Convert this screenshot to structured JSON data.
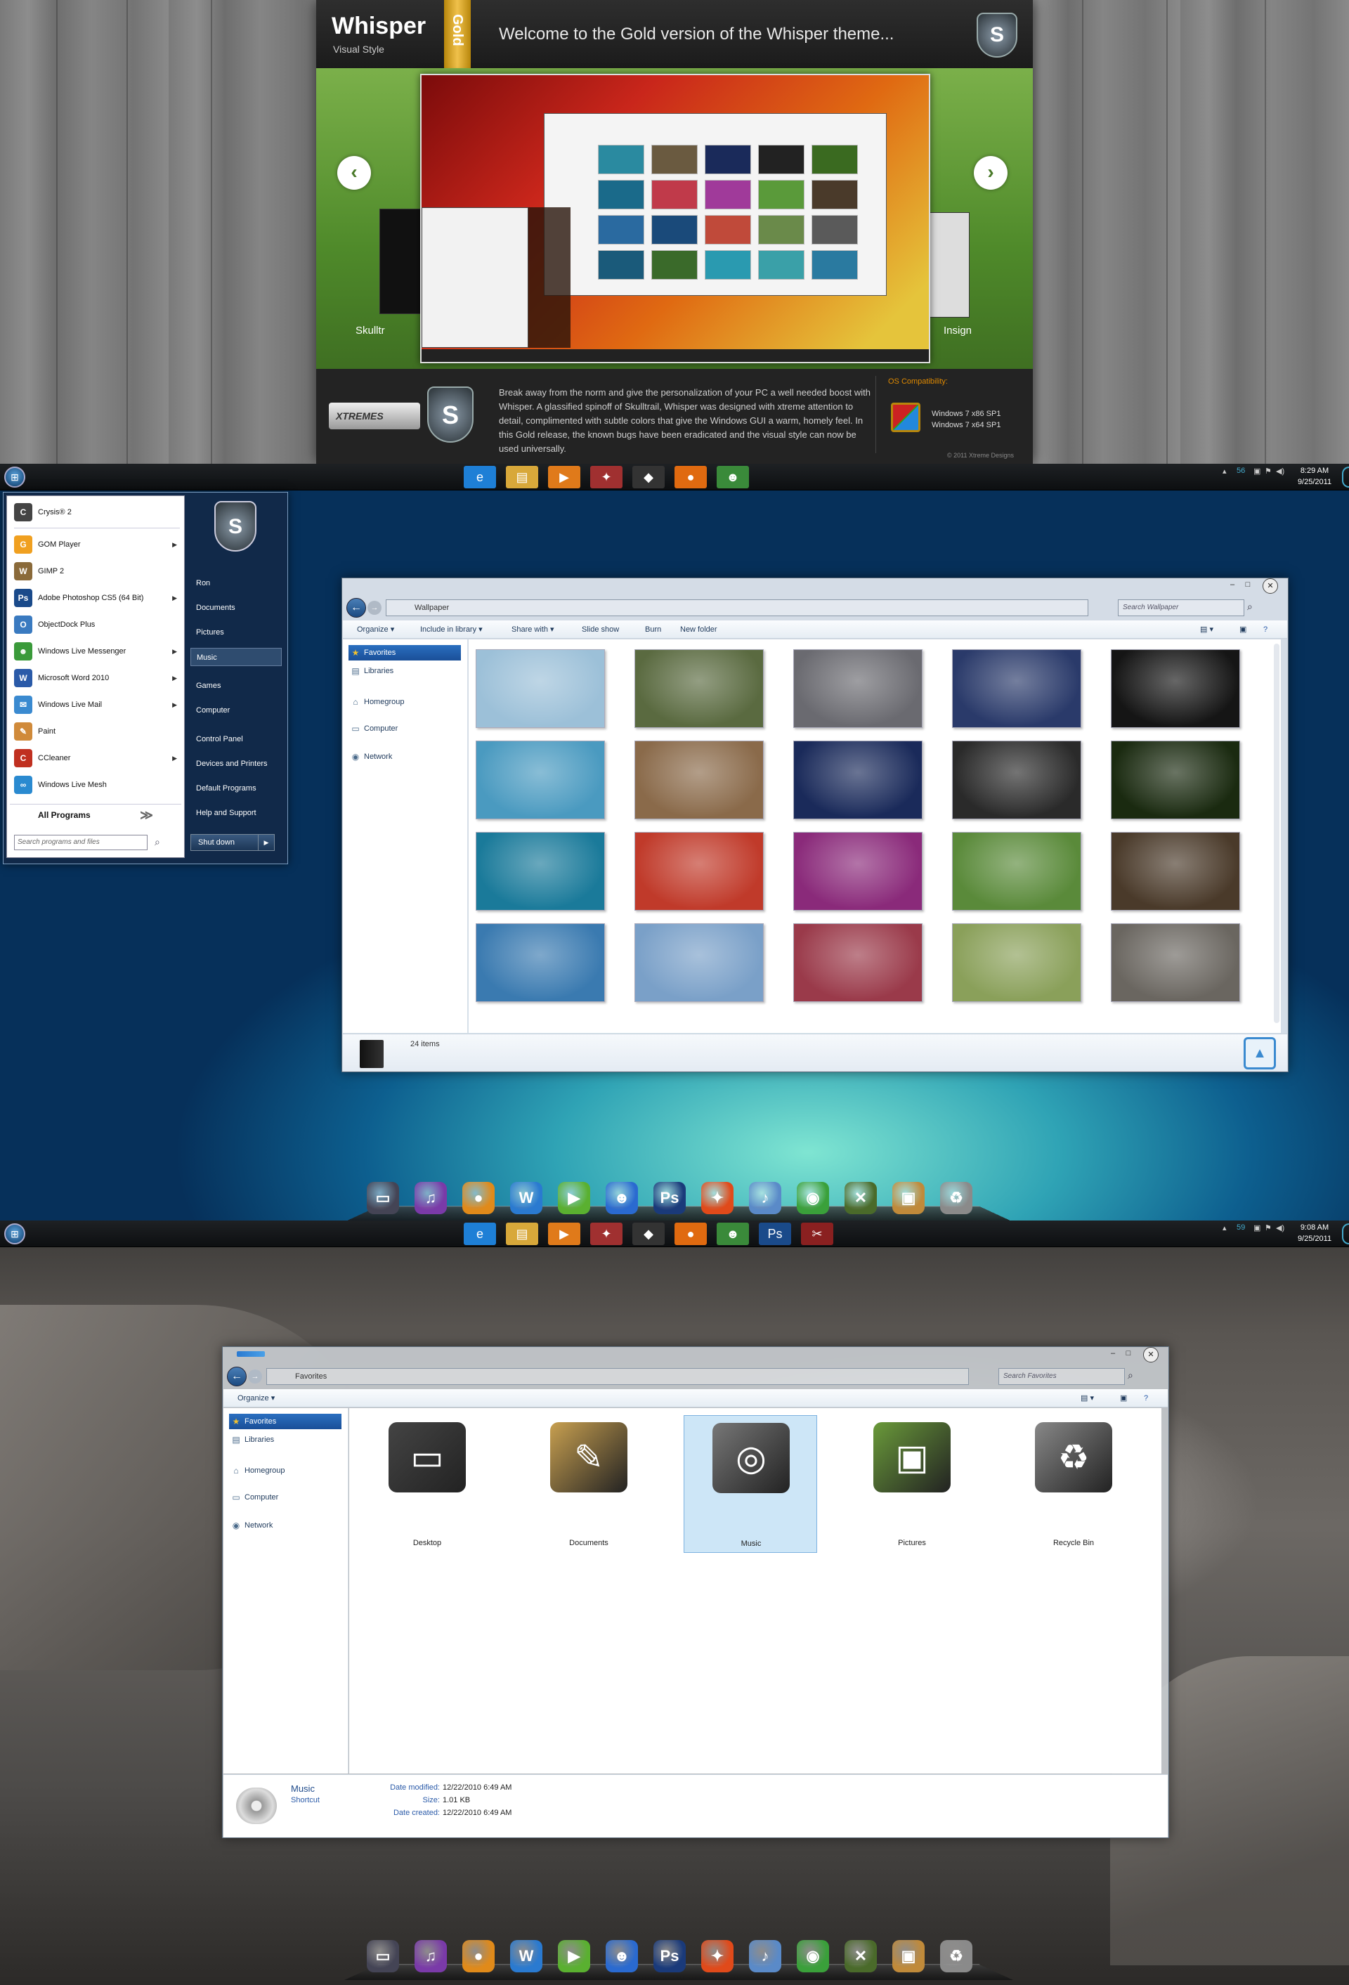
{
  "banner": {
    "logo_title": "Whisper",
    "logo_subtitle": "Visual Style",
    "ribbon_label": "Gold",
    "welcome": "Welcome to the Gold version of the Whisper theme...",
    "badge_letter": "S",
    "prev_arrow": "‹",
    "next_arrow": "›",
    "left_slide_label": "Skulltr",
    "right_slide_label": "Insign",
    "xtreme_logo": "XTREMES",
    "description": "Break away from the norm and give the personalization of your PC a well needed boost with Whisper. A glassified spinoff of Skulltrail, Whisper was designed with xtreme attention to detail, complimented with subtle colors that give the Windows GUI a warm, homely feel. In this Gold release, the known bugs have been eradicated and the visual style can now be used universally.",
    "compat_title": "OS Compatibility:",
    "compat_items": [
      "Windows 7 x86 SP1",
      "Windows 7 x64 SP1"
    ],
    "copyright": "© 2011 Xtreme Designs"
  },
  "taskbar1": {
    "orb": "⊞",
    "icons": [
      {
        "name": "internet-explorer-icon",
        "glyph": "e",
        "color": "#1e7fd6"
      },
      {
        "name": "explorer-icon",
        "glyph": "▤",
        "color": "#d8a83a"
      },
      {
        "name": "media-player-icon",
        "glyph": "▶",
        "color": "#e07a1a"
      },
      {
        "name": "app-icon",
        "glyph": "✦",
        "color": "#a03030"
      },
      {
        "name": "game-icon",
        "glyph": "◆",
        "color": "#333"
      },
      {
        "name": "firefox-icon",
        "glyph": "●",
        "color": "#e06a10"
      },
      {
        "name": "messenger-icon",
        "glyph": "☻",
        "color": "#3a8a3a"
      }
    ],
    "tray_network": "56",
    "clock_time": "8:29 AM",
    "clock_date": "9/25/2011"
  },
  "startmenu": {
    "pinned": {
      "label": "Crysis® 2",
      "icon": "C",
      "color": "#444"
    },
    "items": [
      {
        "label": "GOM Player",
        "icon": "G",
        "color": "#f0a020",
        "arrow": true
      },
      {
        "label": "GIMP 2",
        "icon": "W",
        "color": "#8a6a3a",
        "arrow": false
      },
      {
        "label": "Adobe Photoshop CS5 (64 Bit)",
        "icon": "Ps",
        "color": "#1a4a8a",
        "arrow": true
      },
      {
        "label": "ObjectDock Plus",
        "icon": "O",
        "color": "#3a7ac0",
        "arrow": false
      },
      {
        "label": "Windows Live Messenger",
        "icon": "☻",
        "color": "#3a9a3a",
        "arrow": true
      },
      {
        "label": "Microsoft Word 2010",
        "icon": "W",
        "color": "#2a5aa8",
        "arrow": true
      },
      {
        "label": "Windows Live Mail",
        "icon": "✉",
        "color": "#3a8ad0",
        "arrow": true
      },
      {
        "label": "Paint",
        "icon": "✎",
        "color": "#d08a3a",
        "arrow": false
      },
      {
        "label": "CCleaner",
        "icon": "C",
        "color": "#c03020",
        "arrow": true
      },
      {
        "label": "Windows Live Mesh",
        "icon": "∞",
        "color": "#2a8ad0",
        "arrow": false
      }
    ],
    "all_programs": "All Programs",
    "search_placeholder": "Search programs and files",
    "right_items": [
      "Ron",
      "Documents",
      "Pictures",
      "Music",
      "Games",
      "Computer",
      "Control Panel",
      "Devices and Printers",
      "Default Programs",
      "Help and Support"
    ],
    "shutdown": "Shut down"
  },
  "wallpaper_window": {
    "address": "Wallpaper",
    "search_placeholder": "Search Wallpaper",
    "toolbar": [
      "Organize ▾",
      "Include in library ▾",
      "Share with ▾",
      "Slide show",
      "Burn",
      "New folder"
    ],
    "nav": [
      "Favorites",
      "Libraries",
      "Homegroup",
      "Computer",
      "Network"
    ],
    "status": "24 items",
    "thumbs": [
      "#9cc0d8",
      "#5a6a40",
      "#6a6a70",
      "#2a3a6a",
      "#151515",
      "#4a9ac0",
      "#8a6a4a",
      "#1a2a5a",
      "#2a2a2a",
      "#1a2a10",
      "#1a7a9a",
      "#c03a2a",
      "#8a2a7a",
      "#5a8a3a",
      "#4a3a2a",
      "#3a7ab0",
      "#7aa0c8",
      "#9a3a4a",
      "#8aa05a",
      "#6a6660"
    ]
  },
  "dock1": {
    "icons": [
      {
        "name": "monitor-icon",
        "glyph": "▭",
        "color": "#445"
      },
      {
        "name": "music-icon",
        "glyph": "♫",
        "color": "#7a3aa8"
      },
      {
        "name": "gom-icon",
        "glyph": "●",
        "color": "#e08a1a"
      },
      {
        "name": "live-icon",
        "glyph": "W",
        "color": "#2a7ad0"
      },
      {
        "name": "play-icon",
        "glyph": "▶",
        "color": "#5ab030"
      },
      {
        "name": "messenger-icon",
        "glyph": "☻",
        "color": "#2a6ad0"
      },
      {
        "name": "photoshop-icon",
        "glyph": "Ps",
        "color": "#1a3a7a"
      },
      {
        "name": "fire-icon",
        "glyph": "✦",
        "color": "#e04a1a"
      },
      {
        "name": "itunes-icon",
        "glyph": "♪",
        "color": "#5a8ac8"
      },
      {
        "name": "chrome-icon",
        "glyph": "◉",
        "color": "#3aa03a"
      },
      {
        "name": "xbox-icon",
        "glyph": "✕",
        "color": "#4a6a2a"
      },
      {
        "name": "box-icon",
        "glyph": "▣",
        "color": "#c08a3a"
      },
      {
        "name": "recycle-bin-icon",
        "glyph": "♻",
        "color": "#8a8a8a"
      }
    ]
  },
  "taskbar2": {
    "orb": "⊞",
    "icons": [
      {
        "name": "internet-explorer-icon",
        "glyph": "e",
        "color": "#1e7fd6"
      },
      {
        "name": "explorer-icon",
        "glyph": "▤",
        "color": "#d8a83a"
      },
      {
        "name": "media-player-icon",
        "glyph": "▶",
        "color": "#e07a1a"
      },
      {
        "name": "app-icon",
        "glyph": "✦",
        "color": "#a03030"
      },
      {
        "name": "game-icon",
        "glyph": "◆",
        "color": "#333"
      },
      {
        "name": "firefox-icon",
        "glyph": "●",
        "color": "#e06a10"
      },
      {
        "name": "messenger-icon",
        "glyph": "☻",
        "color": "#3a8a3a"
      },
      {
        "name": "photoshop-icon",
        "glyph": "Ps",
        "color": "#1a4a8a"
      },
      {
        "name": "tools-icon",
        "glyph": "✂",
        "color": "#8a2020"
      }
    ],
    "tray_network": "59",
    "clock_time": "9:08 AM",
    "clock_date": "9/25/2011"
  },
  "favorites_window": {
    "address": "Favorites",
    "search_placeholder": "Search Favorites",
    "toolbar": [
      "Organize ▾"
    ],
    "nav": [
      "Favorites",
      "Libraries",
      "Homegroup",
      "Computer",
      "Network"
    ],
    "items": [
      {
        "label": "Desktop",
        "glyph": "▭",
        "color": "#444"
      },
      {
        "label": "Documents",
        "glyph": "✎",
        "color": "#c8a050"
      },
      {
        "label": "Music",
        "glyph": "◎",
        "color": "#777"
      },
      {
        "label": "Pictures",
        "glyph": "▣",
        "color": "#6a9a3a"
      },
      {
        "label": "Recycle Bin",
        "glyph": "♻",
        "color": "#888"
      }
    ],
    "details": {
      "name": "Music",
      "type": "Shortcut",
      "modified_label": "Date modified:",
      "modified": "12/22/2010 6:49 AM",
      "size_label": "Size:",
      "size": "1.01 KB",
      "created_label": "Date created:",
      "created": "12/22/2010 6:49 AM"
    }
  }
}
